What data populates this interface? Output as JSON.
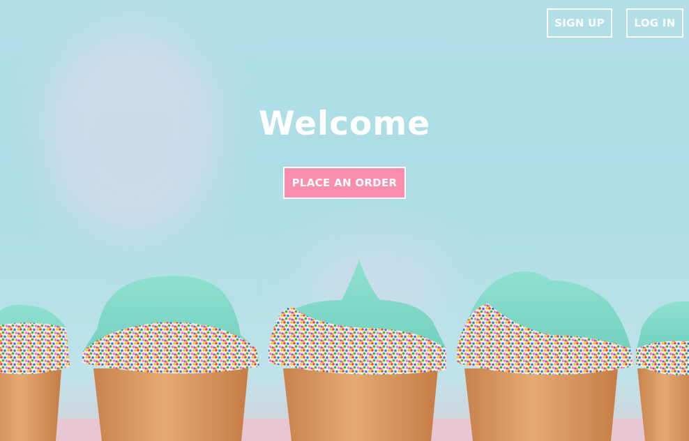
{
  "header": {
    "signup_label": "SIGN UP",
    "login_label": "LOG IN"
  },
  "hero": {
    "title": "Welcome",
    "cta_label": "PLACE AN ORDER",
    "image_subject": "row of cupcakes with mint frosting and rainbow sprinkles",
    "colors": {
      "sky": "#addde6",
      "frosting": "#7dd6c4",
      "cta": "#f98eaf",
      "liner": "#d99660"
    }
  }
}
